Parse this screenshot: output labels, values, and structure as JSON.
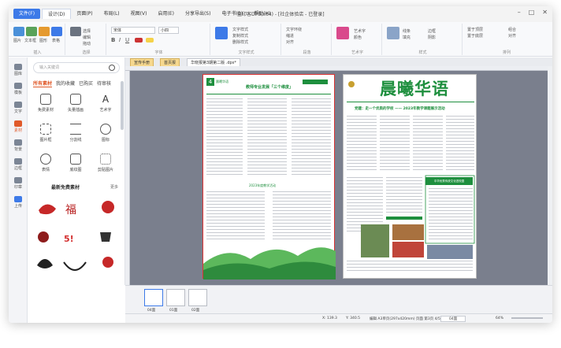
{
  "app": {
    "file_tab": "文件(F)",
    "menus": [
      "设计(D)",
      "页面(P)",
      "布局(L)",
      "视图(V)",
      "启用(E)",
      "分享导出(S)",
      "电子书(B)",
      "帮助(H)"
    ],
    "active_menu_index": 0,
    "window_title": "金印客DPS(x64) - [社企体验店 - 已登录]"
  },
  "ribbon": {
    "groups": [
      {
        "name": "插入",
        "buttons": [
          "图片",
          "文本框",
          "图形",
          "表格",
          "页面"
        ]
      },
      {
        "name": "选择",
        "buttons": [
          "选择",
          "编辑",
          "拖动"
        ]
      },
      {
        "name": "字体",
        "font": "宋体",
        "size": "小四"
      },
      {
        "name": "文字样式",
        "buttons": [
          "文字样式",
          "复制样式",
          "删除样式"
        ]
      },
      {
        "name": "段落",
        "buttons": [
          "文字环绕",
          "缩进",
          "对齐"
        ]
      },
      {
        "name": "艺术字",
        "buttons": [
          "艺术字",
          "颜色",
          "艺术"
        ]
      },
      {
        "name": "样式",
        "buttons": [
          "线条",
          "填充",
          "边框",
          "阴影"
        ]
      },
      {
        "name": "排列",
        "buttons": [
          "置于顶层",
          "置于底层",
          "组合",
          "对齐"
        ]
      }
    ]
  },
  "sidebar_icons": [
    {
      "label": "图库",
      "icon": "image-library-icon"
    },
    {
      "label": "模板",
      "icon": "template-icon"
    },
    {
      "label": "文字",
      "icon": "text-icon"
    },
    {
      "label": "素材",
      "icon": "material-icon",
      "active": true
    },
    {
      "label": "背景",
      "icon": "background-icon"
    },
    {
      "label": "边框",
      "icon": "border-icon"
    },
    {
      "label": "印章",
      "icon": "stamp-icon"
    },
    {
      "label": "上传",
      "icon": "upload-icon"
    }
  ],
  "panel": {
    "search_placeholder": "输入关键词",
    "tabs": [
      "所有素材",
      "我的收藏",
      "已购买",
      "待审核"
    ],
    "active_tab": 0,
    "tiles": [
      {
        "label": "免费素材",
        "icon": "gift-icon"
      },
      {
        "label": "矢量插画",
        "icon": "vector-icon"
      },
      {
        "label": "艺术字",
        "icon": "font-a-icon"
      },
      {
        "label": "图片框",
        "icon": "frame-icon"
      },
      {
        "label": "分割线",
        "icon": "divider-icon"
      },
      {
        "label": "图标",
        "icon": "shapes-icon"
      },
      {
        "label": "表情",
        "icon": "smiley-icon"
      },
      {
        "label": "底纹图",
        "icon": "pattern-icon"
      },
      {
        "label": "剪贴图片",
        "icon": "clip-icon"
      }
    ],
    "section_title": "最新免费素材",
    "section_more": "更多"
  },
  "doc_tabs": [
    {
      "label": "宣传手册",
      "active": false
    },
    {
      "label": "首页报",
      "active": false
    },
    {
      "label": "华晓报第3期第二版 .dps*",
      "active": true
    }
  ],
  "newspaper": {
    "left_page_num": "4",
    "left_header": "晨曦华语",
    "left_headline": "教师专业发展「三个维度」",
    "right_masthead": "晨曦华语",
    "right_headline": "党建：走一个优质的学校 —— 2023年教学课题展示活动",
    "section_caption_left": "2023年度教学活动",
    "box_title": "中华优秀传统文化进校园"
  },
  "thumbnails": [
    {
      "label": "04面",
      "active": true
    },
    {
      "label": "01面",
      "active": false
    },
    {
      "label": "02面",
      "active": false
    }
  ],
  "status": {
    "coords": "X: 139.3",
    "coords_y": "Y: 340.5",
    "page_info": "编辑  A3单页(297x420mm)  页面  第3页  4/5",
    "zoom": "64%",
    "page_select": "04面"
  },
  "colors": {
    "accent": "#3d7ae8",
    "highlight": "#e05a2a",
    "masthead_green": "#1e8f3e",
    "canvas": "#7a7f8d"
  }
}
